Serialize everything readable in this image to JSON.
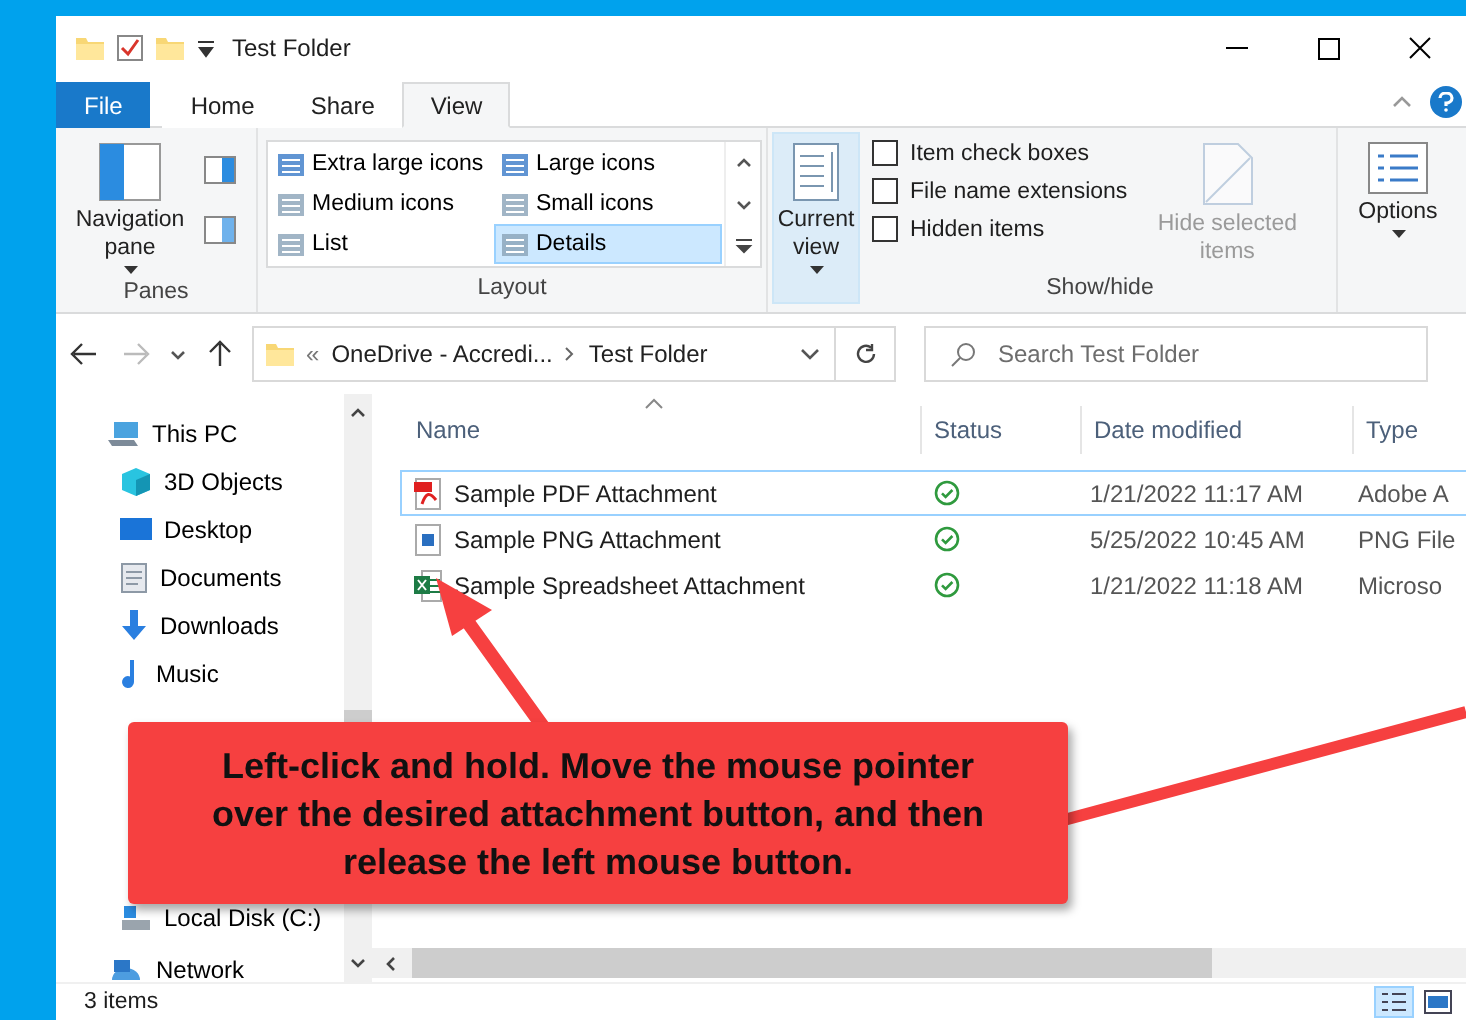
{
  "window": {
    "title": "Test Folder"
  },
  "ribbon": {
    "tabs": [
      {
        "label": "File",
        "kind": "file",
        "selected": false
      },
      {
        "label": "Home",
        "kind": "tab",
        "selected": false
      },
      {
        "label": "Share",
        "kind": "tab",
        "selected": false
      },
      {
        "label": "View",
        "kind": "tab",
        "selected": true
      }
    ],
    "panes": {
      "label": "Panes",
      "navigation_pane": "Navigation pane"
    },
    "layout": {
      "label": "Layout",
      "options": [
        {
          "label": "Extra large icons",
          "selected": false
        },
        {
          "label": "Large icons",
          "selected": false
        },
        {
          "label": "Medium icons",
          "selected": false
        },
        {
          "label": "Small icons",
          "selected": false
        },
        {
          "label": "List",
          "selected": false
        },
        {
          "label": "Details",
          "selected": true
        }
      ]
    },
    "current_view": {
      "label": "Current view"
    },
    "show_hide": {
      "label": "Show/hide",
      "checkboxes": [
        {
          "label": "Item check boxes",
          "checked": false
        },
        {
          "label": "File name extensions",
          "checked": false
        },
        {
          "label": "Hidden items",
          "checked": false
        }
      ],
      "hide_selected": {
        "label": "Hide selected items",
        "disabled": true
      }
    },
    "options": {
      "label": "Options"
    }
  },
  "address": {
    "overflow_mark": "«",
    "segments": [
      "OneDrive - Accredi...",
      "Test Folder"
    ]
  },
  "search": {
    "placeholder": "Search Test Folder"
  },
  "sidebar": {
    "items": [
      {
        "label": "This PC",
        "kind": "pc"
      },
      {
        "label": "3D Objects",
        "kind": "objects"
      },
      {
        "label": "Desktop",
        "kind": "desktop"
      },
      {
        "label": "Documents",
        "kind": "documents"
      },
      {
        "label": "Downloads",
        "kind": "downloads"
      },
      {
        "label": "Music",
        "kind": "music"
      },
      {
        "label": "Local Disk (C:)",
        "kind": "drive"
      },
      {
        "label": "Network",
        "kind": "network"
      }
    ]
  },
  "table": {
    "columns": [
      "Name",
      "Status",
      "Date modified",
      "Type"
    ],
    "rows": [
      {
        "name": "Sample PDF Attachment",
        "kind": "pdf",
        "synced": true,
        "date": "1/21/2022 11:17 AM",
        "type": "Adobe A",
        "focused": true
      },
      {
        "name": "Sample PNG Attachment",
        "kind": "image",
        "synced": true,
        "date": "5/25/2022 10:45 AM",
        "type": "PNG File",
        "focused": false
      },
      {
        "name": "Sample Spreadsheet Attachment",
        "kind": "sheet",
        "synced": true,
        "date": "1/21/2022 11:18 AM",
        "type": "Microso",
        "focused": false
      }
    ]
  },
  "status_bar": {
    "count": "3 items"
  },
  "callout": {
    "text": "Left-click and hold. Move the mouse pointer over the desired attachment button, and then release the left mouse button."
  }
}
